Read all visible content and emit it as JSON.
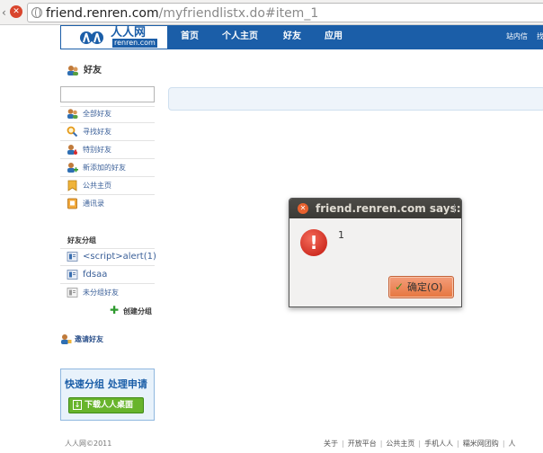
{
  "browser": {
    "url_host": "friend.renren.com",
    "url_path": "/myfriendlistx.do#item_1"
  },
  "topnav": {
    "logo_name": "人人网",
    "logo_domain": "renren.com",
    "links": [
      "首页",
      "个人主页",
      "好友",
      "应用"
    ],
    "right_links": [
      "站内信",
      "找"
    ]
  },
  "sidebar": {
    "title": "好友",
    "items": [
      {
        "label": "全部好友",
        "icon": "friends-icon"
      },
      {
        "label": "寻找好友",
        "icon": "search-icon"
      },
      {
        "label": "特别好友",
        "icon": "special-friend-icon"
      },
      {
        "label": "新添加的好友",
        "icon": "new-friend-icon"
      },
      {
        "label": "公共主页",
        "icon": "bookmark-icon"
      },
      {
        "label": "通讯录",
        "icon": "address-book-icon"
      }
    ],
    "group_title": "好友分组",
    "groups": [
      {
        "label": "<script>alert(1)",
        "icon": "group-icon"
      },
      {
        "label": "fdsaa",
        "icon": "group-icon"
      },
      {
        "label": "未分组好友",
        "icon": "group-icon"
      }
    ],
    "create_group": "创建分组",
    "invite": "邀请好友"
  },
  "promo": {
    "title": "快速分组 处理申请",
    "button": "下载人人桌面"
  },
  "dialog": {
    "title": "friend.renren.com says:",
    "message": "1",
    "ok_label": "确定(O)"
  },
  "footer": {
    "copyright": "人人网©2011",
    "links": [
      "关于",
      "开放平台",
      "公共主页",
      "手机人人",
      "糯米网团购",
      "人"
    ]
  }
}
